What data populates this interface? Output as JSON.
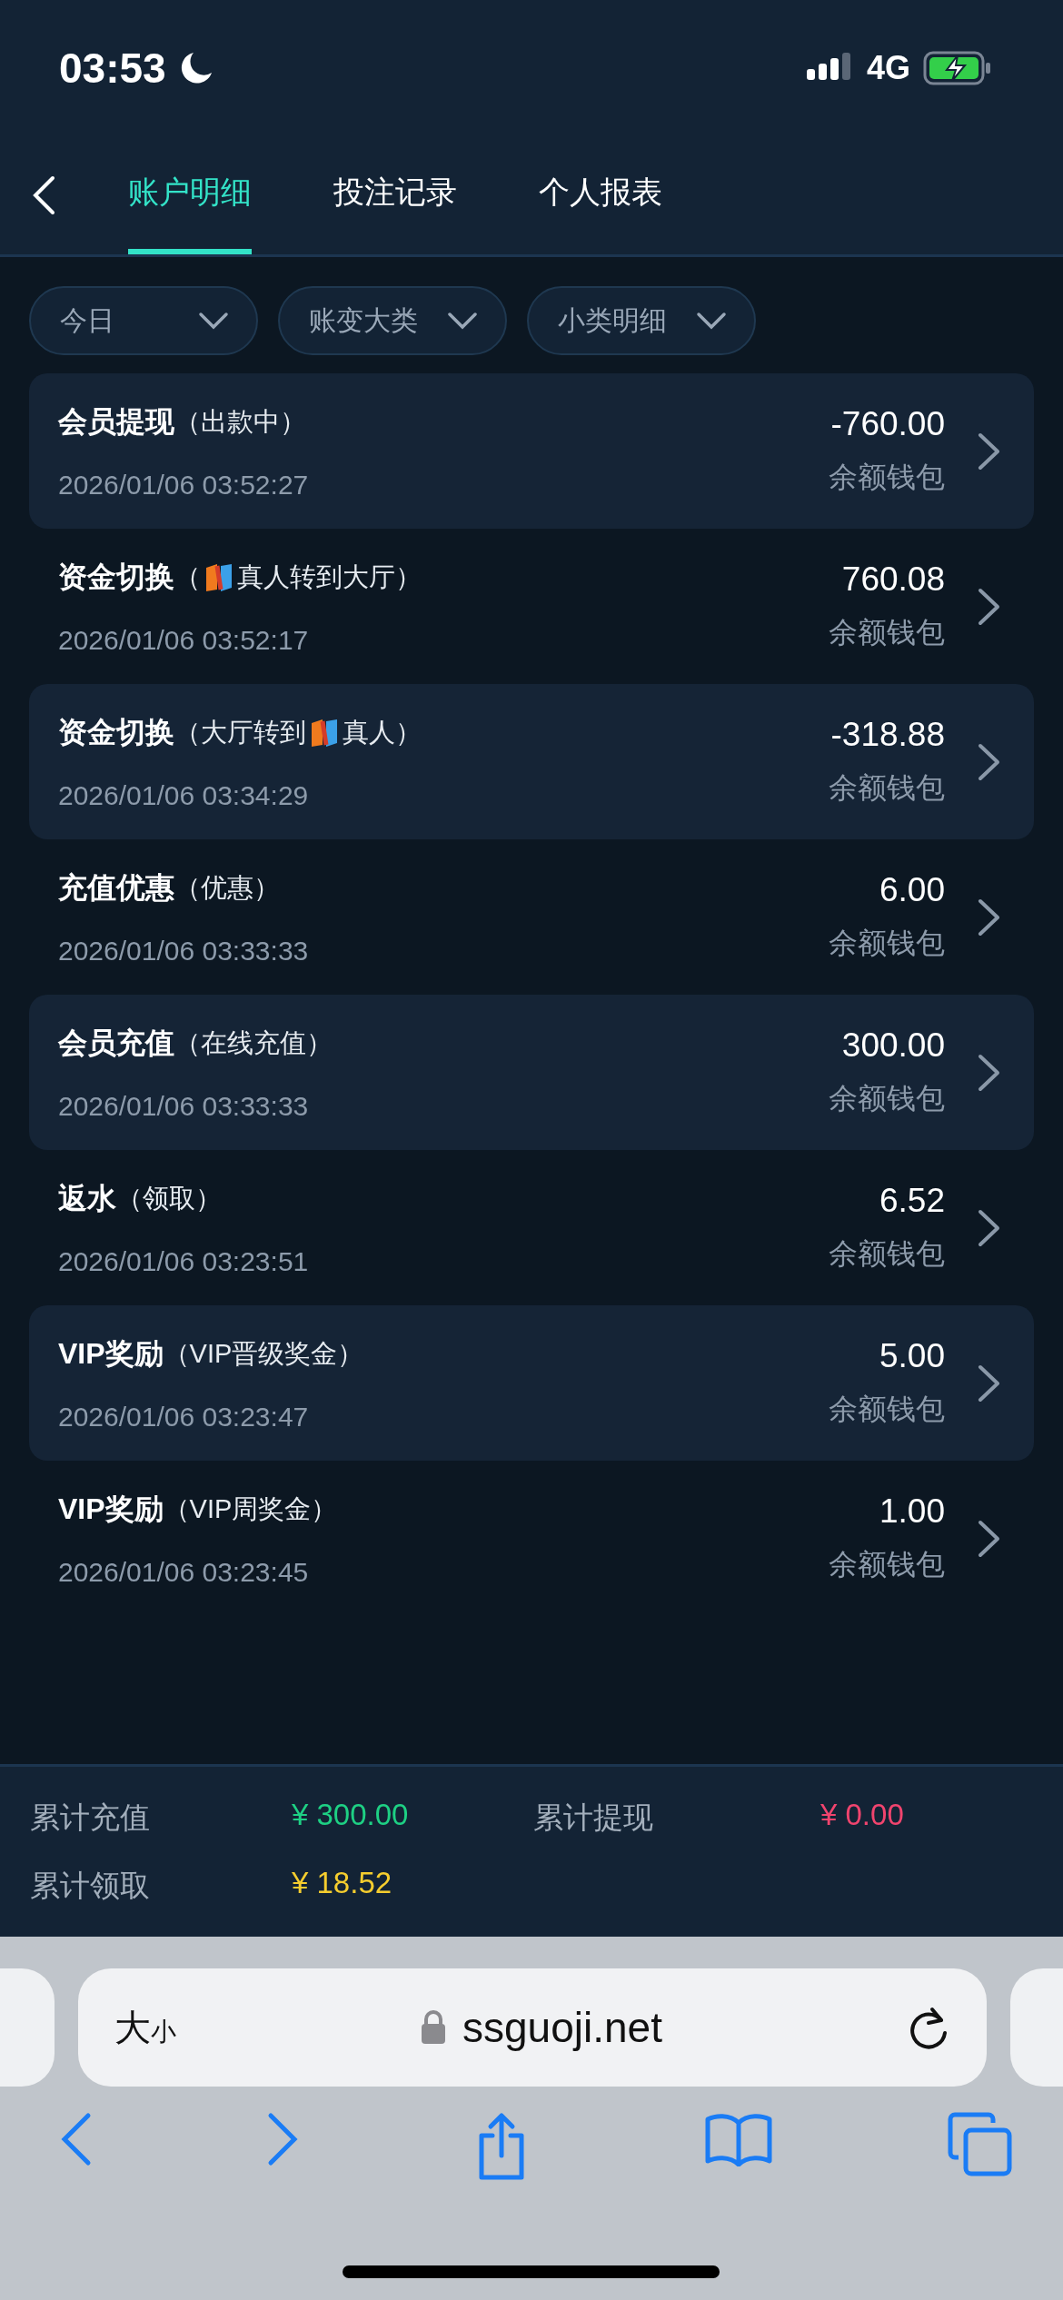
{
  "status_bar": {
    "time": "03:53",
    "network": "4G"
  },
  "tabs": [
    {
      "label": "账户明细",
      "selected": true
    },
    {
      "label": "投注记录",
      "selected": false
    },
    {
      "label": "个人报表",
      "selected": false
    }
  ],
  "filters": [
    {
      "label": "今日"
    },
    {
      "label": "账变大类"
    },
    {
      "label": "小类明细"
    }
  ],
  "records": [
    {
      "title": "会员提现",
      "detail": [
        {
          "kind": "text",
          "text": "（出款中）"
        }
      ],
      "amount": "-760.00",
      "wallet": "余额钱包",
      "time": "2026/01/06 03:52:27"
    },
    {
      "title": "资金切换",
      "detail": [
        {
          "kind": "text",
          "text": "（"
        },
        {
          "kind": "logo"
        },
        {
          "kind": "text",
          "text": "真人转到大厅）"
        }
      ],
      "amount": "760.08",
      "wallet": "余额钱包",
      "time": "2026/01/06 03:52:17"
    },
    {
      "title": "资金切换",
      "detail": [
        {
          "kind": "text",
          "text": "（大厅转到"
        },
        {
          "kind": "logo"
        },
        {
          "kind": "text",
          "text": "真人）"
        }
      ],
      "amount": "-318.88",
      "wallet": "余额钱包",
      "time": "2026/01/06 03:34:29"
    },
    {
      "title": "充值优惠",
      "detail": [
        {
          "kind": "text",
          "text": "（优惠）"
        }
      ],
      "amount": "6.00",
      "wallet": "余额钱包",
      "time": "2026/01/06 03:33:33"
    },
    {
      "title": "会员充值",
      "detail": [
        {
          "kind": "text",
          "text": "（在线充值）"
        }
      ],
      "amount": "300.00",
      "wallet": "余额钱包",
      "time": "2026/01/06 03:33:33"
    },
    {
      "title": "返水",
      "detail": [
        {
          "kind": "text",
          "text": "（领取）"
        }
      ],
      "amount": "6.52",
      "wallet": "余额钱包",
      "time": "2026/01/06 03:23:51"
    },
    {
      "title": "VIP奖励",
      "detail": [
        {
          "kind": "text",
          "text": "（VIP晋级奖金）"
        }
      ],
      "amount": "5.00",
      "wallet": "余额钱包",
      "time": "2026/01/06 03:23:47"
    },
    {
      "title": "VIP奖励",
      "detail": [
        {
          "kind": "text",
          "text": "（VIP周奖金）"
        }
      ],
      "amount": "1.00",
      "wallet": "余额钱包",
      "time": "2026/01/06 03:23:45"
    }
  ],
  "summary": [
    {
      "label": "累计充值",
      "value": "¥ 300.00",
      "color": "#1ed084"
    },
    {
      "label": "累计提现",
      "value": "¥ 0.00",
      "color": "#f0446e"
    },
    {
      "label": "累计领取",
      "value": "¥ 18.52",
      "color": "#f5cd2e"
    }
  ],
  "browser": {
    "text_size": "大",
    "text_size_small": "小",
    "url": "ssguoji.net"
  }
}
